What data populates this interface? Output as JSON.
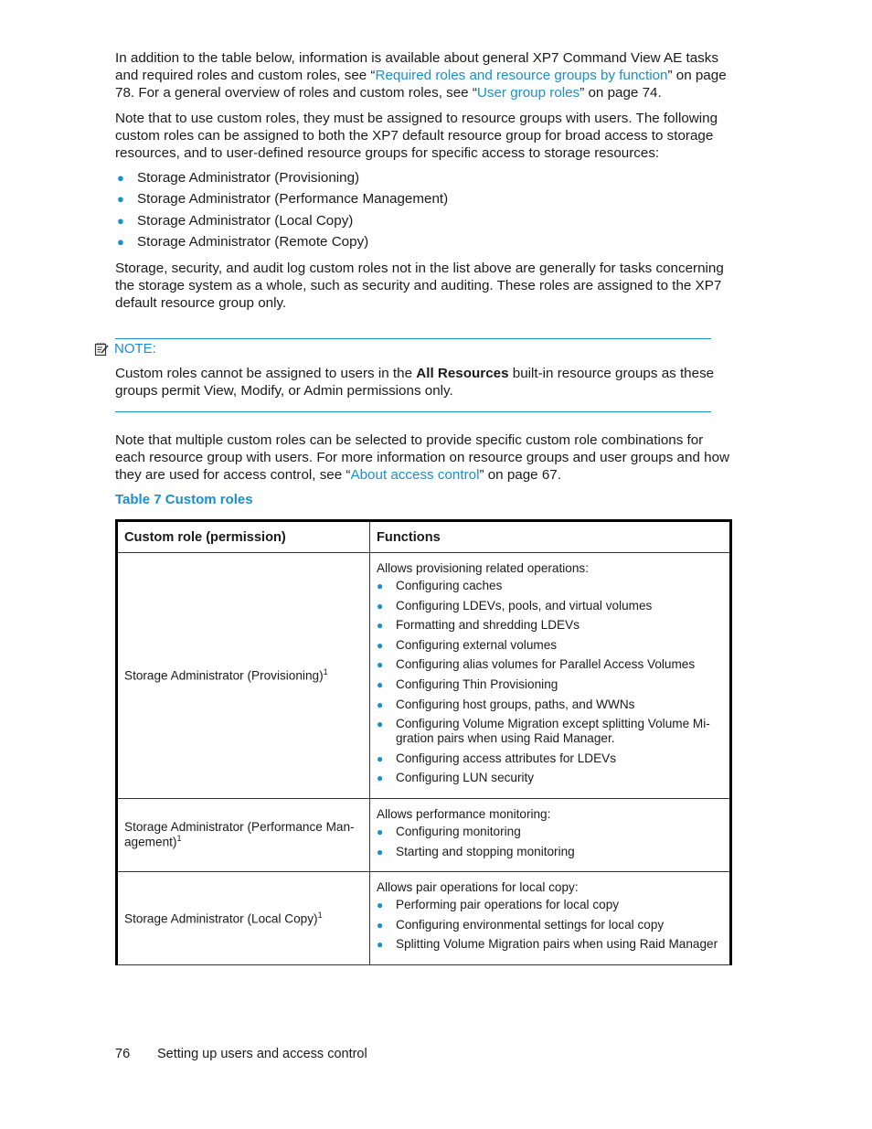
{
  "intro": {
    "p1_a": "In addition to the table below, information is available about general XP7 Command View AE tasks and required roles and custom roles, see “",
    "p1_link1": "Required roles and resource groups by function",
    "p1_b": "” on page 78. For a general overview of roles and custom roles, see “",
    "p1_link2": "User group roles",
    "p1_c": "” on page 74.",
    "p2": "Note that to use custom roles, they must be assigned to resource groups with users. The following custom roles can be assigned to both the XP7 default resource group for broad access to storage resources, and to user-defined resource groups for specific access to storage resources:",
    "bullets": [
      "Storage Administrator (Provisioning)",
      "Storage Administrator (Performance Management)",
      "Storage Administrator (Local Copy)",
      "Storage Administrator (Remote Copy)"
    ],
    "p3": "Storage, security, and audit log custom roles not in the list above are generally for tasks concerning the storage system as a whole, such as security and auditing. These roles are assigned to the XP7 default resource group only."
  },
  "note": {
    "icon": "note-icon",
    "label": "NOTE:",
    "text_a": "Custom roles cannot be assigned to users in the ",
    "text_bold": "All Resources",
    "text_b": " built-in resource groups as these groups permit View, Modify, or Admin permissions only."
  },
  "after_note": {
    "p_a": "Note that multiple custom roles can be selected to provide specific custom role combinations for each resource group with users. For more information on resource groups and user groups and how they are used for access control, see “",
    "p_link": "About access control",
    "p_b": "” on page 67."
  },
  "table": {
    "caption": "Table 7 Custom roles",
    "headers": [
      "Custom role (permission)",
      "Functions"
    ],
    "rows": [
      {
        "role": "Storage Administrator (Provisioning)",
        "footnote": "1",
        "intro": "Allows provisioning related operations:",
        "items": [
          "Configuring caches",
          "Configuring LDEVs, pools, and virtual volumes",
          "Formatting and shredding LDEVs",
          "Configuring external volumes",
          "Configuring alias volumes for Parallel Access Volumes",
          "Configuring Thin Provisioning",
          "Configuring host groups, paths, and WWNs",
          "Configuring Volume Migration except splitting Volume Mi-gration pairs when using Raid Manager.",
          "Configuring access attributes for LDEVs",
          "Configuring LUN security"
        ]
      },
      {
        "role": "Storage Administrator (Performance Man-agement)",
        "footnote": "1",
        "intro": "Allows performance monitoring:",
        "items": [
          "Configuring monitoring",
          "Starting and stopping monitoring"
        ]
      },
      {
        "role": "Storage Administrator (Local Copy)",
        "footnote": "1",
        "intro": "Allows pair operations for local copy:",
        "items": [
          "Performing pair operations for local copy",
          "Configuring environmental settings for local copy",
          "Splitting Volume Migration pairs when using Raid Manager"
        ]
      }
    ]
  },
  "footer": {
    "page_number": "76",
    "section": "Setting up users and access control"
  },
  "colors": {
    "accent": "#1a8fcf",
    "text": "#1a1a1a"
  }
}
